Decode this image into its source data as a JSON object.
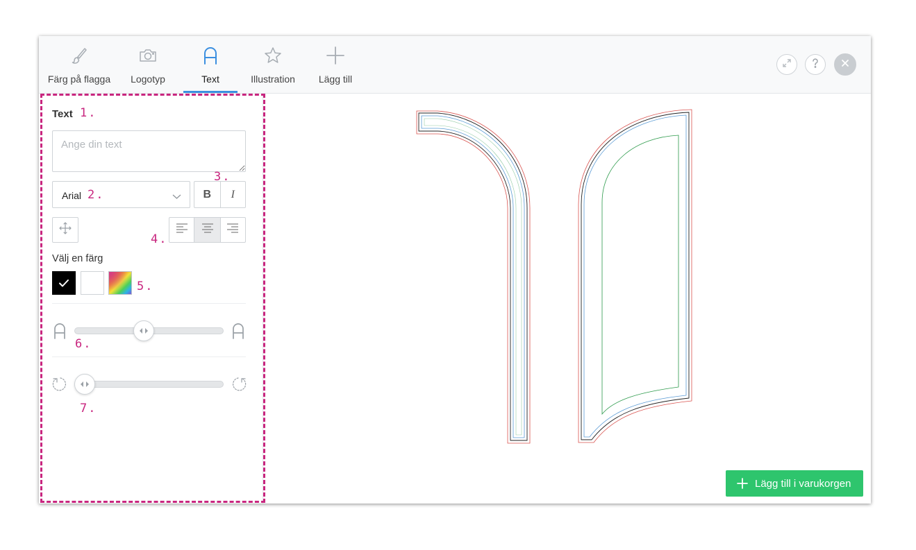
{
  "tabs": [
    {
      "id": "flag-color",
      "label": "Färg på flagga",
      "icon": "brush-icon",
      "active": false
    },
    {
      "id": "logo",
      "label": "Logotyp",
      "icon": "camera-icon",
      "active": false
    },
    {
      "id": "text",
      "label": "Text",
      "icon": "letter-a-icon",
      "active": true
    },
    {
      "id": "illustration",
      "label": "Illustration",
      "icon": "star-icon",
      "active": false
    },
    {
      "id": "add",
      "label": "Lägg till",
      "icon": "plus-icon",
      "active": false
    }
  ],
  "header_buttons": [
    "fullscreen-icon",
    "help-icon",
    "close-icon"
  ],
  "text_panel": {
    "title": "Text",
    "placeholder": "Ange din text",
    "font_value": "Arial",
    "bold_label": "B",
    "italic_label": "I",
    "color_title": "Välj en färg",
    "selected_color": "#000000",
    "colors": [
      "#000000",
      "#ffffff",
      "gradient"
    ],
    "size_slider_fraction": 0.46,
    "rotation_slider_fraction": 0.0
  },
  "annotations": [
    "1.",
    "2.",
    "3.",
    "4.",
    "5.",
    "6.",
    "7."
  ],
  "cart_button": {
    "label": "Lägg till i varukorgen"
  },
  "accent_colors": {
    "tab_underline": "#3b8fe0",
    "cart_green": "#2ec56d",
    "annotation_pink": "#c8267f"
  }
}
